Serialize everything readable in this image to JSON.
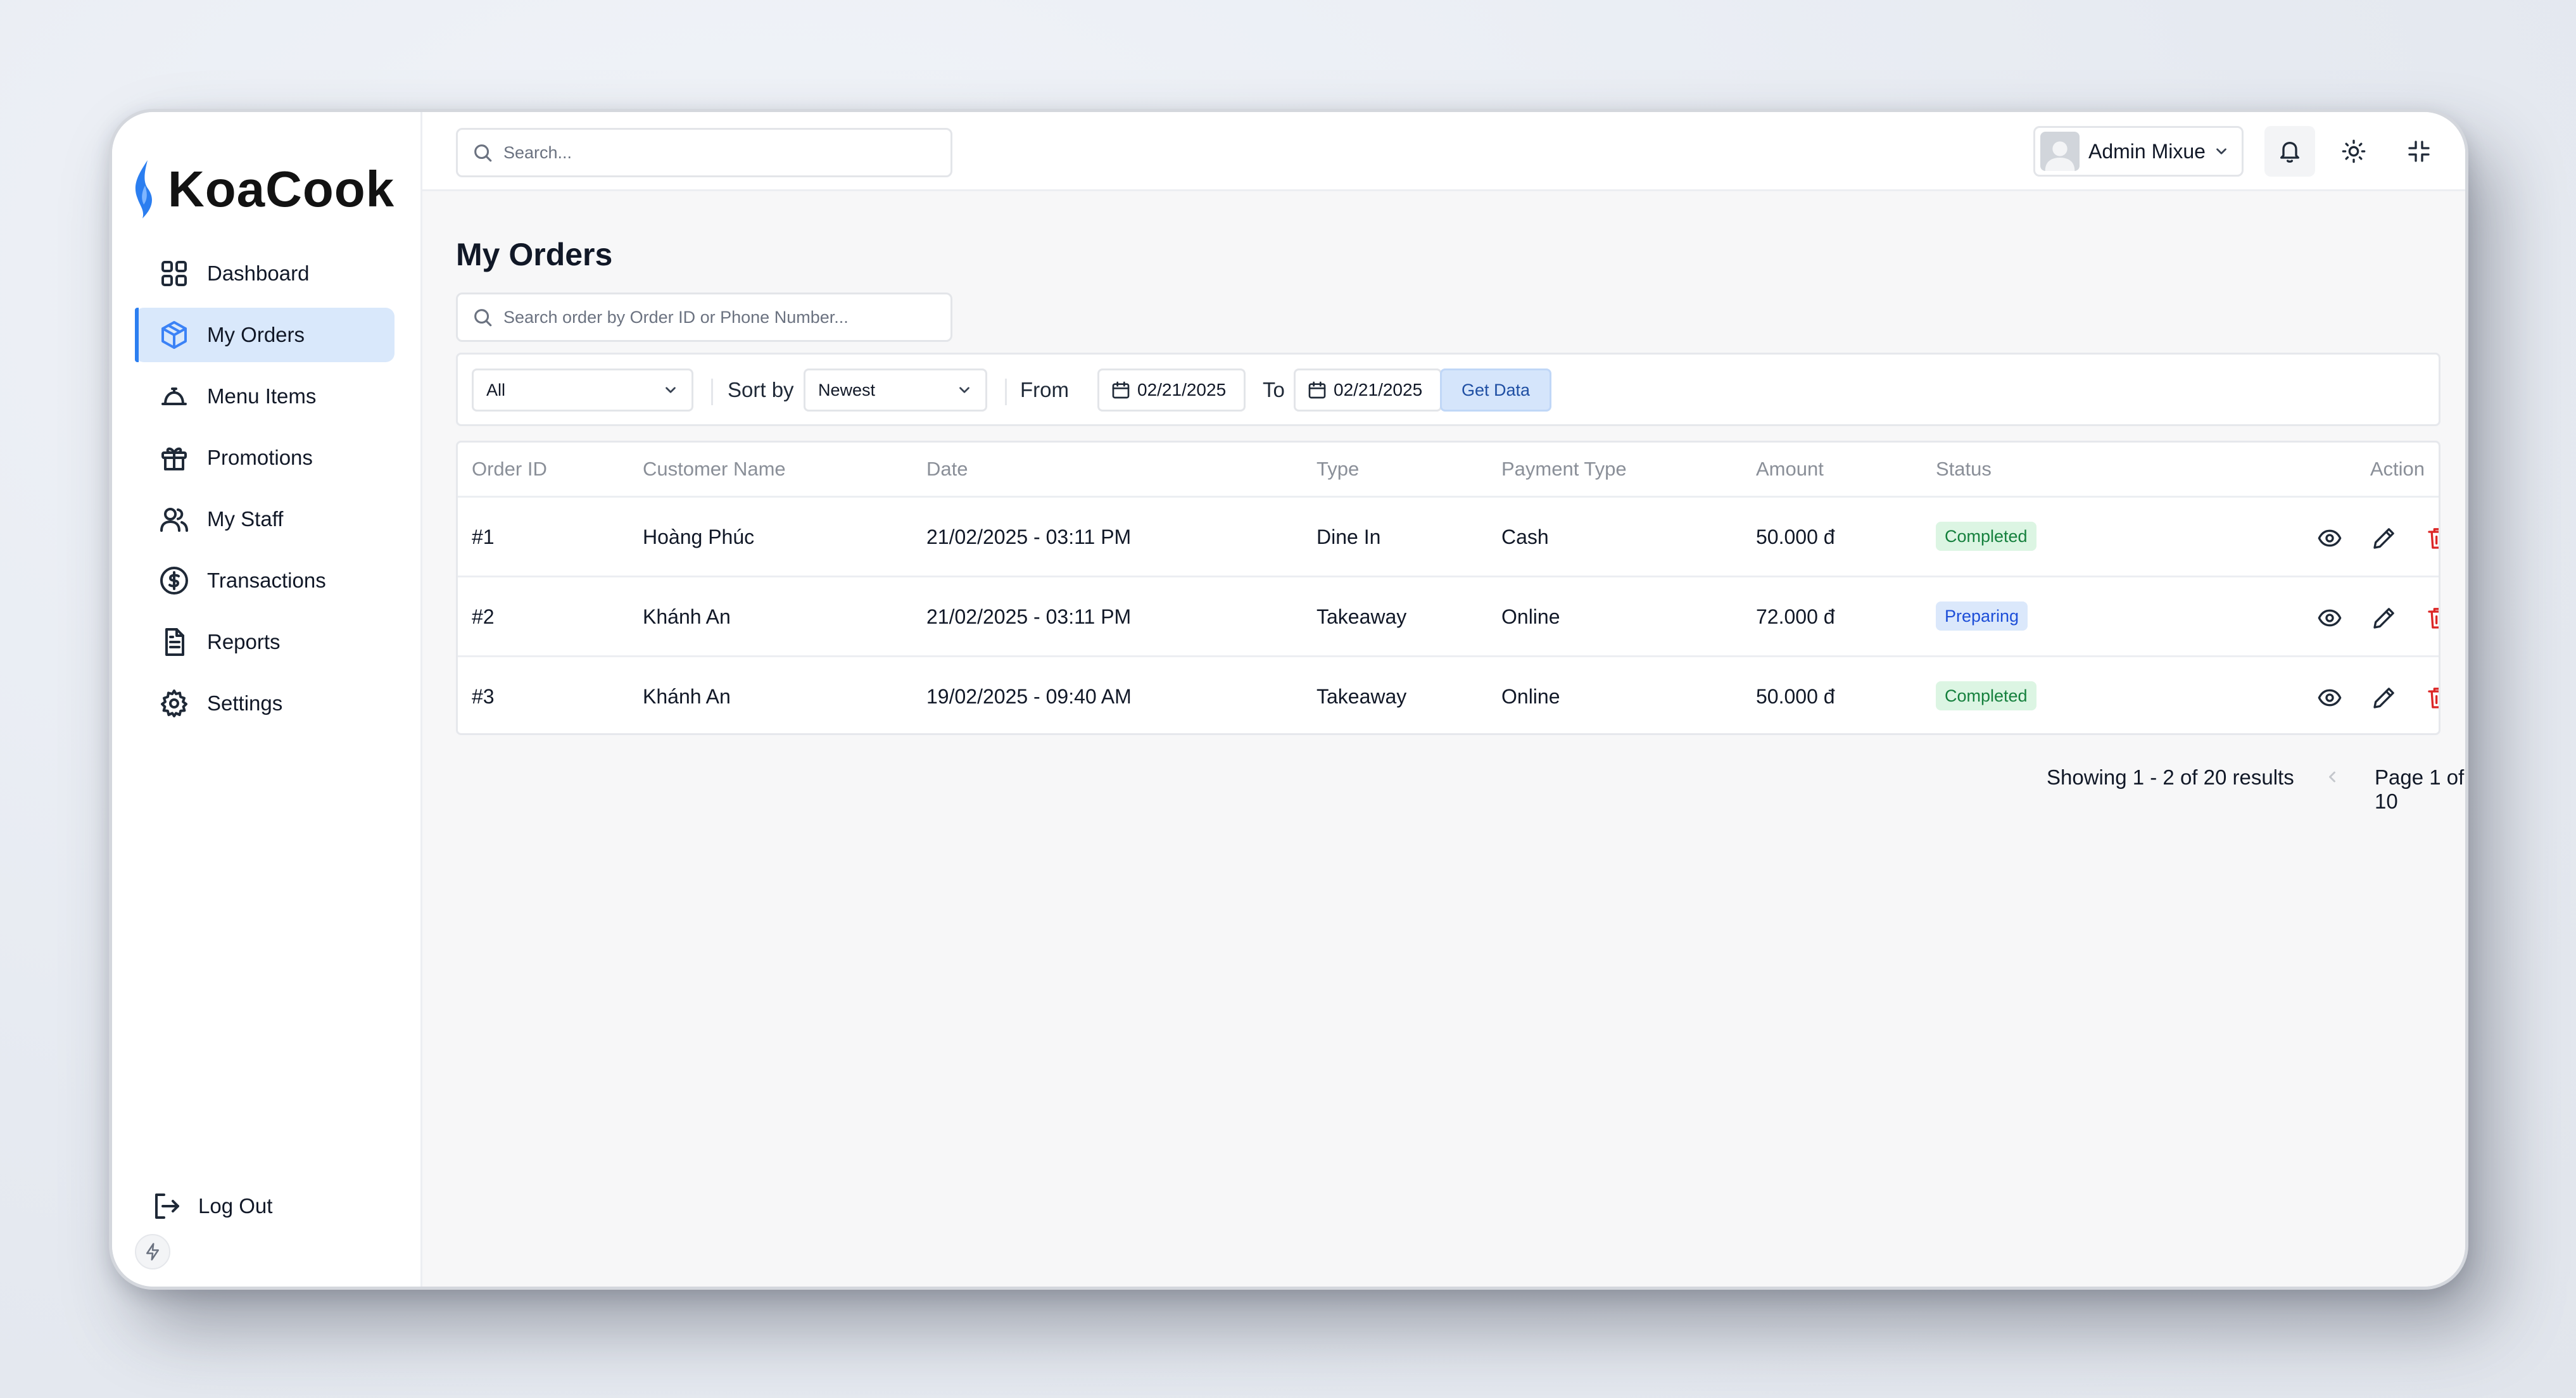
{
  "app": {
    "name": "KoaCook"
  },
  "sidebar": {
    "items": [
      {
        "label": "Dashboard",
        "icon": "dashboard-icon"
      },
      {
        "label": "My Orders",
        "icon": "box-icon",
        "active": true
      },
      {
        "label": "Menu Items",
        "icon": "cloche-icon"
      },
      {
        "label": "Promotions",
        "icon": "gift-icon"
      },
      {
        "label": "My Staff",
        "icon": "users-icon"
      },
      {
        "label": "Transactions",
        "icon": "dollar-circle-icon"
      },
      {
        "label": "Reports",
        "icon": "document-icon"
      },
      {
        "label": "Settings",
        "icon": "gear-icon"
      }
    ],
    "logout_label": "Log Out"
  },
  "topbar": {
    "search_placeholder": "Search...",
    "user_name": "Admin Mixue"
  },
  "page": {
    "title": "My Orders",
    "search_placeholder": "Search order by Order ID or Phone Number..."
  },
  "filters": {
    "type_value": "All",
    "sort_label": "Sort by",
    "sort_value": "Newest",
    "from_label": "From",
    "from_date": "02/21/2025",
    "to_label": "To",
    "to_date": "02/21/2025",
    "get_data_label": "Get Data"
  },
  "table": {
    "headers": [
      "Order ID",
      "Customer Name",
      "Date",
      "Type",
      "Payment Type",
      "Amount",
      "Status",
      "Action"
    ],
    "rows": [
      {
        "id": "#1",
        "customer": "Hoàng Phúc",
        "date": "21/02/2025 - 03:11 PM",
        "type": "Dine In",
        "payment": "Cash",
        "amount": "50.000 đ",
        "status": "Completed"
      },
      {
        "id": "#2",
        "customer": "Khánh An",
        "date": "21/02/2025 - 03:11 PM",
        "type": "Takeaway",
        "payment": "Online",
        "amount": "72.000 đ",
        "status": "Preparing"
      },
      {
        "id": "#3",
        "customer": "Khánh An",
        "date": "19/02/2025 - 09:40 AM",
        "type": "Takeaway",
        "payment": "Online",
        "amount": "50.000 đ",
        "status": "Completed"
      }
    ]
  },
  "pagination": {
    "showing": "Showing 1 - 2 of 20 results",
    "page_info": "Page 1 of 10"
  },
  "colors": {
    "accent": "#3b82f6",
    "active_bg": "#d9e8fb",
    "completed_bg": "#dcf5e3",
    "completed_text": "#15803d",
    "preparing_bg": "#dbe8fb",
    "preparing_text": "#1d4ed8",
    "delete": "#dc2626"
  }
}
